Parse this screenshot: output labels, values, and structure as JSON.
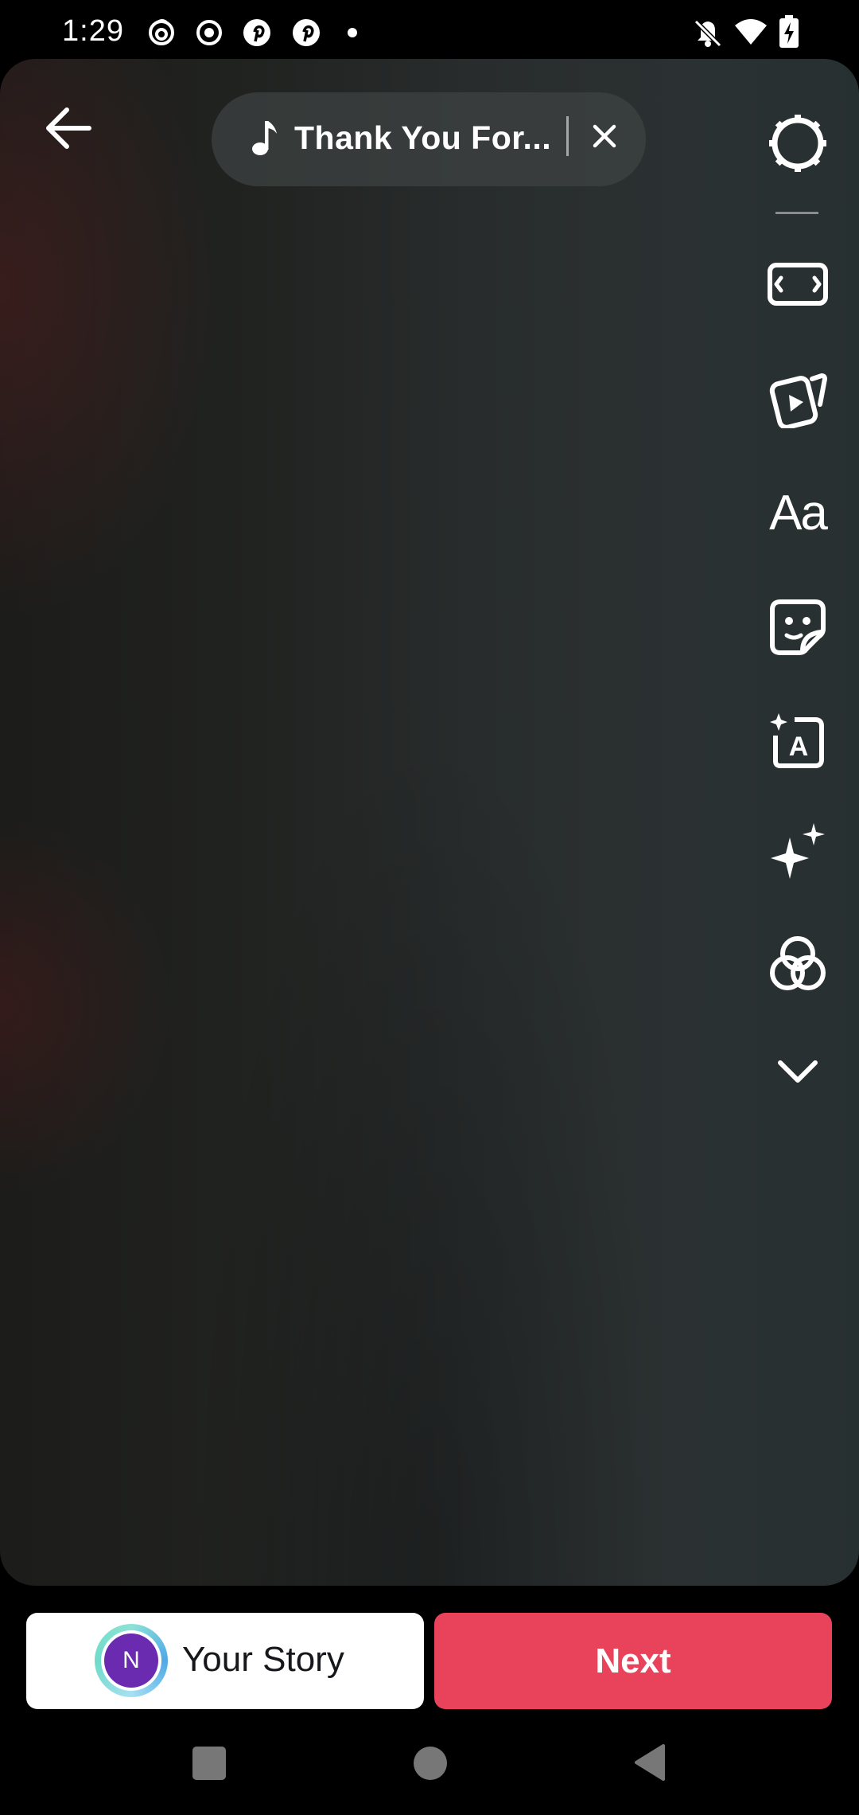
{
  "status_bar": {
    "time": "1:29",
    "icons": [
      "threads-icon",
      "record-icon",
      "pinterest-icon",
      "pinterest-icon",
      "dot-icon",
      "notifications-off-icon",
      "wifi-icon",
      "battery-charging-icon"
    ]
  },
  "editor": {
    "music": {
      "title": "Thank You For..."
    },
    "tools": [
      "settings-icon",
      "aspect-ratio-icon",
      "clips-icon",
      "text-icon",
      "sticker-icon",
      "ai-text-icon",
      "effects-sparkle-icon",
      "filters-icon",
      "chevron-down-icon"
    ],
    "text_tool_label": "Aa"
  },
  "bottom_bar": {
    "your_story_label": "Your Story",
    "avatar_initial": "N",
    "next_label": "Next"
  },
  "colors": {
    "next_button": "#e8435a",
    "avatar": "#6b2bb0"
  }
}
